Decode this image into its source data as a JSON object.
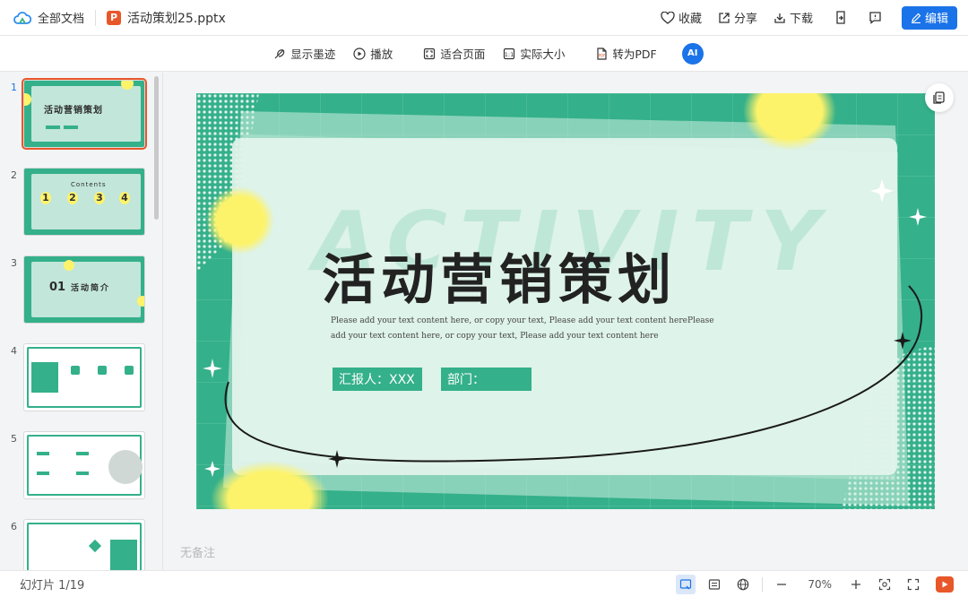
{
  "topbar": {
    "all_docs": "全部文档",
    "file_badge": "P",
    "filename": "活动策划25.pptx",
    "favorite": "收藏",
    "share": "分享",
    "download": "下载",
    "edit": "编辑"
  },
  "toolbar": {
    "show_ink": "显示墨迹",
    "play": "播放",
    "fit_page": "适合页面",
    "actual_size": "实际大小",
    "to_pdf": "转为PDF",
    "ai_label": "AI"
  },
  "sidebar": {
    "thumbnails": [
      {
        "num": "1",
        "title": "活动营销策划"
      },
      {
        "num": "2",
        "title": "Contents",
        "items": [
          "1",
          "2",
          "3",
          "4"
        ]
      },
      {
        "num": "3",
        "title": "活动简介",
        "index": "01"
      },
      {
        "num": "4"
      },
      {
        "num": "5"
      },
      {
        "num": "6"
      }
    ]
  },
  "slide": {
    "watermark": "ACTIVITY",
    "title": "活动营销策划",
    "body_line1": "Please add your text content here, or copy     your text, Please add your text content herePlease",
    "body_line2": "add your text content here, or copy     your text, Please add your text content here",
    "reporter": "汇报人：XXX",
    "department": "部门："
  },
  "notes": "无备注",
  "statusbar": {
    "slide_count": "幻灯片 1/19",
    "zoom": "70%"
  },
  "colors": {
    "accent": "#1a73e8",
    "slide_green": "#34b08a",
    "ppt_orange": "#e8572a",
    "yellow_dot": "#fdf36b"
  }
}
